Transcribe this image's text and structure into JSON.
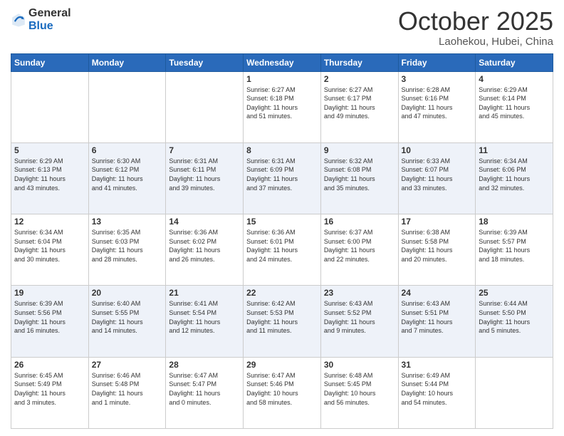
{
  "header": {
    "logo_general": "General",
    "logo_blue": "Blue",
    "month": "October 2025",
    "location": "Laohekou, Hubei, China"
  },
  "weekdays": [
    "Sunday",
    "Monday",
    "Tuesday",
    "Wednesday",
    "Thursday",
    "Friday",
    "Saturday"
  ],
  "weeks": [
    [
      {
        "day": "",
        "info": ""
      },
      {
        "day": "",
        "info": ""
      },
      {
        "day": "",
        "info": ""
      },
      {
        "day": "1",
        "info": "Sunrise: 6:27 AM\nSunset: 6:18 PM\nDaylight: 11 hours\nand 51 minutes."
      },
      {
        "day": "2",
        "info": "Sunrise: 6:27 AM\nSunset: 6:17 PM\nDaylight: 11 hours\nand 49 minutes."
      },
      {
        "day": "3",
        "info": "Sunrise: 6:28 AM\nSunset: 6:16 PM\nDaylight: 11 hours\nand 47 minutes."
      },
      {
        "day": "4",
        "info": "Sunrise: 6:29 AM\nSunset: 6:14 PM\nDaylight: 11 hours\nand 45 minutes."
      }
    ],
    [
      {
        "day": "5",
        "info": "Sunrise: 6:29 AM\nSunset: 6:13 PM\nDaylight: 11 hours\nand 43 minutes."
      },
      {
        "day": "6",
        "info": "Sunrise: 6:30 AM\nSunset: 6:12 PM\nDaylight: 11 hours\nand 41 minutes."
      },
      {
        "day": "7",
        "info": "Sunrise: 6:31 AM\nSunset: 6:11 PM\nDaylight: 11 hours\nand 39 minutes."
      },
      {
        "day": "8",
        "info": "Sunrise: 6:31 AM\nSunset: 6:09 PM\nDaylight: 11 hours\nand 37 minutes."
      },
      {
        "day": "9",
        "info": "Sunrise: 6:32 AM\nSunset: 6:08 PM\nDaylight: 11 hours\nand 35 minutes."
      },
      {
        "day": "10",
        "info": "Sunrise: 6:33 AM\nSunset: 6:07 PM\nDaylight: 11 hours\nand 33 minutes."
      },
      {
        "day": "11",
        "info": "Sunrise: 6:34 AM\nSunset: 6:06 PM\nDaylight: 11 hours\nand 32 minutes."
      }
    ],
    [
      {
        "day": "12",
        "info": "Sunrise: 6:34 AM\nSunset: 6:04 PM\nDaylight: 11 hours\nand 30 minutes."
      },
      {
        "day": "13",
        "info": "Sunrise: 6:35 AM\nSunset: 6:03 PM\nDaylight: 11 hours\nand 28 minutes."
      },
      {
        "day": "14",
        "info": "Sunrise: 6:36 AM\nSunset: 6:02 PM\nDaylight: 11 hours\nand 26 minutes."
      },
      {
        "day": "15",
        "info": "Sunrise: 6:36 AM\nSunset: 6:01 PM\nDaylight: 11 hours\nand 24 minutes."
      },
      {
        "day": "16",
        "info": "Sunrise: 6:37 AM\nSunset: 6:00 PM\nDaylight: 11 hours\nand 22 minutes."
      },
      {
        "day": "17",
        "info": "Sunrise: 6:38 AM\nSunset: 5:58 PM\nDaylight: 11 hours\nand 20 minutes."
      },
      {
        "day": "18",
        "info": "Sunrise: 6:39 AM\nSunset: 5:57 PM\nDaylight: 11 hours\nand 18 minutes."
      }
    ],
    [
      {
        "day": "19",
        "info": "Sunrise: 6:39 AM\nSunset: 5:56 PM\nDaylight: 11 hours\nand 16 minutes."
      },
      {
        "day": "20",
        "info": "Sunrise: 6:40 AM\nSunset: 5:55 PM\nDaylight: 11 hours\nand 14 minutes."
      },
      {
        "day": "21",
        "info": "Sunrise: 6:41 AM\nSunset: 5:54 PM\nDaylight: 11 hours\nand 12 minutes."
      },
      {
        "day": "22",
        "info": "Sunrise: 6:42 AM\nSunset: 5:53 PM\nDaylight: 11 hours\nand 11 minutes."
      },
      {
        "day": "23",
        "info": "Sunrise: 6:43 AM\nSunset: 5:52 PM\nDaylight: 11 hours\nand 9 minutes."
      },
      {
        "day": "24",
        "info": "Sunrise: 6:43 AM\nSunset: 5:51 PM\nDaylight: 11 hours\nand 7 minutes."
      },
      {
        "day": "25",
        "info": "Sunrise: 6:44 AM\nSunset: 5:50 PM\nDaylight: 11 hours\nand 5 minutes."
      }
    ],
    [
      {
        "day": "26",
        "info": "Sunrise: 6:45 AM\nSunset: 5:49 PM\nDaylight: 11 hours\nand 3 minutes."
      },
      {
        "day": "27",
        "info": "Sunrise: 6:46 AM\nSunset: 5:48 PM\nDaylight: 11 hours\nand 1 minute."
      },
      {
        "day": "28",
        "info": "Sunrise: 6:47 AM\nSunset: 5:47 PM\nDaylight: 11 hours\nand 0 minutes."
      },
      {
        "day": "29",
        "info": "Sunrise: 6:47 AM\nSunset: 5:46 PM\nDaylight: 10 hours\nand 58 minutes."
      },
      {
        "day": "30",
        "info": "Sunrise: 6:48 AM\nSunset: 5:45 PM\nDaylight: 10 hours\nand 56 minutes."
      },
      {
        "day": "31",
        "info": "Sunrise: 6:49 AM\nSunset: 5:44 PM\nDaylight: 10 hours\nand 54 minutes."
      },
      {
        "day": "",
        "info": ""
      }
    ]
  ]
}
